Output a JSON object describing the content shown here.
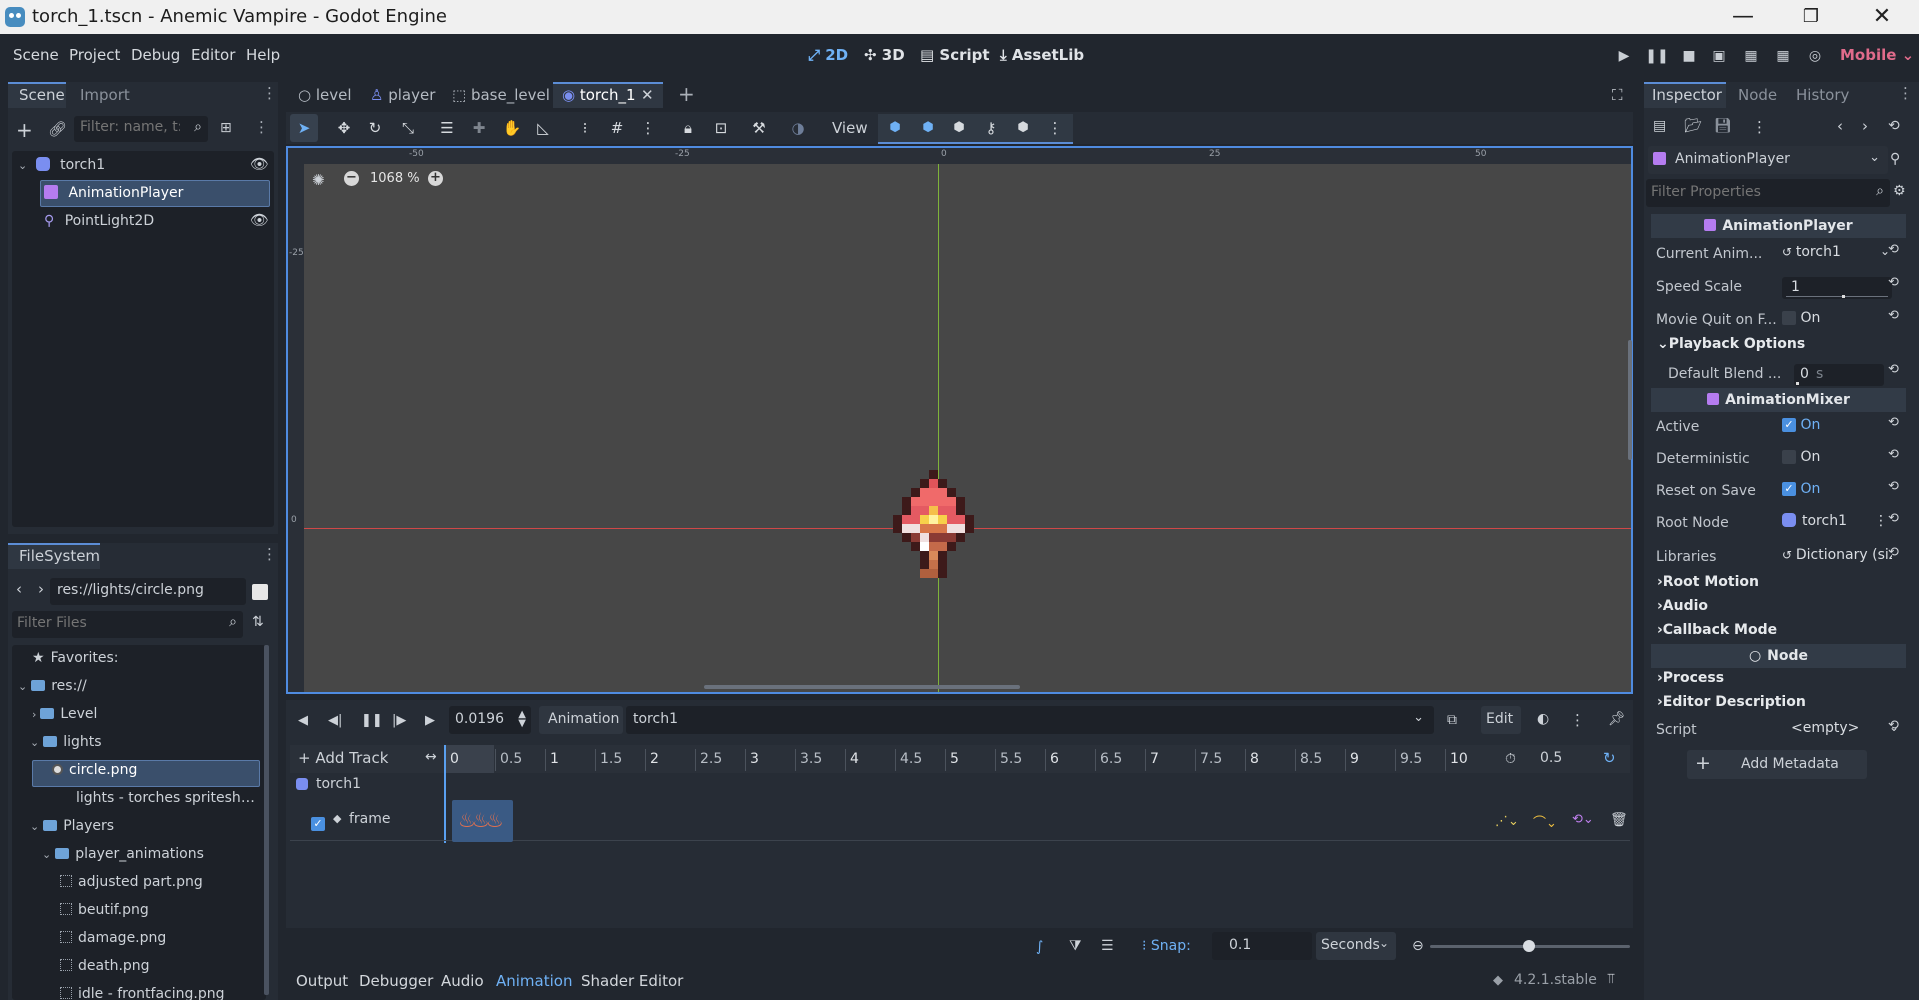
{
  "window": {
    "title": "torch_1.tscn - Anemic Vampire - Godot Engine",
    "min_glyph": "—",
    "max_glyph": "❐",
    "close_glyph": "✕"
  },
  "menu": {
    "items": [
      "Scene",
      "Project",
      "Debug",
      "Editor",
      "Help"
    ],
    "workspaces": [
      "2D",
      "3D",
      "Script",
      "AssetLib"
    ],
    "renderer": "Mobile"
  },
  "scene_dock": {
    "tabs": [
      "Scene",
      "Import"
    ],
    "filter_placeholder": "Filter: name, t:t",
    "nodes": [
      {
        "name": "torch1",
        "icon": "node2d-icon"
      },
      {
        "name": "AnimationPlayer",
        "icon": "animation-player-icon"
      },
      {
        "name": "PointLight2D",
        "icon": "point-light-icon"
      }
    ]
  },
  "filesystem": {
    "tab": "FileSystem",
    "path": "res://lights/circle.png",
    "filter_placeholder": "Filter Files",
    "items": [
      {
        "label": "Favorites:",
        "type": "star"
      },
      {
        "label": "res://",
        "type": "folder"
      },
      {
        "label": "Level",
        "type": "folder"
      },
      {
        "label": "lights",
        "type": "folder"
      },
      {
        "label": "circle.png",
        "type": "file"
      },
      {
        "label": "lights - torches spritesheet.png",
        "type": "file"
      },
      {
        "label": "Players",
        "type": "folder"
      },
      {
        "label": "player_animations",
        "type": "folder"
      },
      {
        "label": "adjusted part.png",
        "type": "file"
      },
      {
        "label": "beutif.png",
        "type": "file"
      },
      {
        "label": "damage.png",
        "type": "file"
      },
      {
        "label": "death.png",
        "type": "file"
      },
      {
        "label": "idle - frontfacing.png",
        "type": "file"
      }
    ]
  },
  "editor_tabs": [
    "level",
    "player",
    "base_level",
    "torch_1"
  ],
  "toolbar": {
    "view_label": "View"
  },
  "viewport": {
    "zoom": "1068 %",
    "ruler_h": [
      "-50",
      "-25",
      "0",
      "25",
      "50"
    ],
    "ruler_v": [
      "-25",
      "0"
    ]
  },
  "animation": {
    "time": "0.0196",
    "animation_label": "Animation",
    "animation_name": "torch1",
    "edit_label": "Edit",
    "add_track": "Add Track",
    "ticks": [
      "0",
      "0.5",
      "1",
      "1.5",
      "2",
      "2.5",
      "3",
      "3.5",
      "4",
      "4.5",
      "5",
      "5.5",
      "6",
      "6.5",
      "7",
      "7.5",
      "8",
      "8.5",
      "9",
      "9.5",
      "10"
    ],
    "length": "0.5",
    "track_node": "torch1",
    "track_property": "frame",
    "snap_label": "Snap:",
    "snap_value": "0.1",
    "snap_unit": "Seconds"
  },
  "bottom_tabs": [
    "Output",
    "Debugger",
    "Audio",
    "Animation",
    "Shader Editor"
  ],
  "version": "4.2.1.stable",
  "inspector": {
    "tabs": [
      "Inspector",
      "Node",
      "History"
    ],
    "object": "AnimationPlayer",
    "filter_placeholder": "Filter Properties",
    "section1": "AnimationPlayer",
    "current_anim_label": "Current Anim...",
    "current_anim": "torch1",
    "speed_scale_label": "Speed Scale",
    "speed_scale": "1",
    "movie_quit_label": "Movie Quit on F...",
    "on": "On",
    "playback_options": "Playback Options",
    "default_blend_label": "Default Blend ...",
    "default_blend": "0",
    "default_blend_unit": "s",
    "section2": "AnimationMixer",
    "active_label": "Active",
    "deterministic_label": "Deterministic",
    "reset_on_save_label": "Reset on Save",
    "root_node_label": "Root Node",
    "root_node": "torch1",
    "libraries_label": "Libraries",
    "libraries": "Dictionary (siz",
    "root_motion": "Root Motion",
    "audio": "Audio",
    "callback_mode": "Callback Mode",
    "section3": "Node",
    "process": "Process",
    "editor_description": "Editor Description",
    "script_label": "Script",
    "script_value": "<empty>",
    "add_metadata": "Add Metadata"
  },
  "colors": {
    "accent": "#6fb1f5",
    "renderer": "#e06b8b",
    "x_axis": "#d04848",
    "y_axis": "#7fb33a"
  }
}
